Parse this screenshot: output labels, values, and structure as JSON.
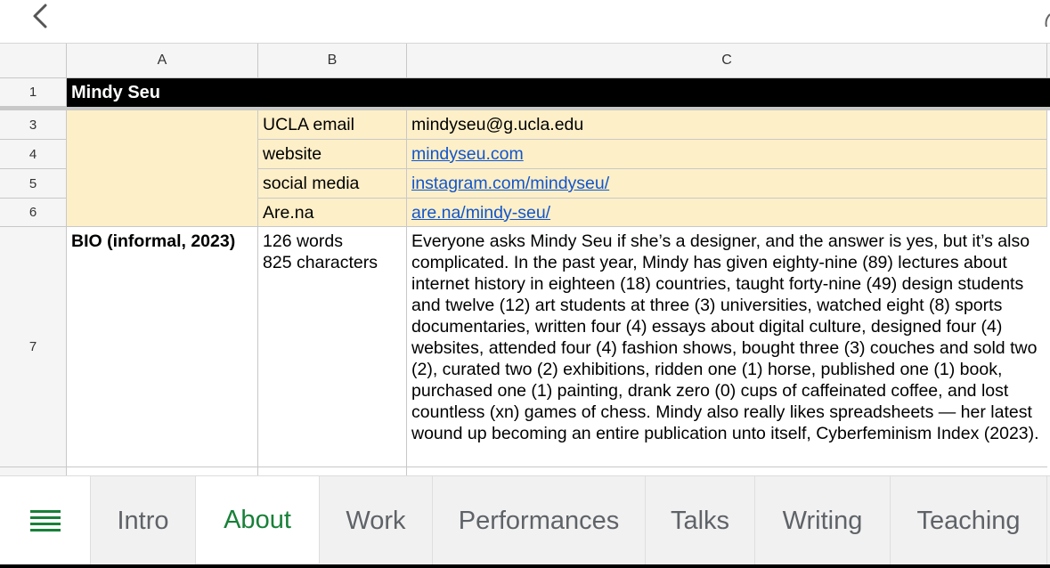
{
  "columns": [
    "A",
    "B",
    "C"
  ],
  "rows": [
    "1",
    "3",
    "4",
    "5",
    "6",
    "7"
  ],
  "title": "Mindy Seu",
  "contacts": [
    {
      "label": "UCLA email",
      "value": "mindyseu@g.ucla.edu"
    },
    {
      "label": "website",
      "value": "mindyseu.com"
    },
    {
      "label": "social media",
      "value": "instagram.com/mindyseu/"
    },
    {
      "label": "Are.na",
      "value": "are.na/mindy-seu/"
    }
  ],
  "bio": {
    "label": "BIO (informal, 2023)",
    "words": "126 words",
    "characters": "825 characters",
    "text": "Everyone asks Mindy Seu if she’s a designer, and the answer is yes, but it’s also complicated. In the past year, Mindy has given eighty-nine (89) lectures about internet history in eighteen (18) countries, taught forty-nine (49) design students and twelve (12) art students at three (3) universities, watched eight (8) sports documentaries, written four (4) essays about digital culture, designed four (4) websites, attended four (4) fashion shows, bought three (3) couches and sold two (2), curated two (2) exhibitions, ridden one (1) horse, published one (1) book, purchased one (1) painting, drank zero (0) cups of caffeinated coffee, and lost countless (xn) games of chess. Mindy also really likes spreadsheets — her latest wound up becoming an entire publication unto itself, Cyberfeminism Index (2023)."
  },
  "tabs": [
    "Intro",
    "About",
    "Work",
    "Performances",
    "Talks",
    "Writing",
    "Teaching"
  ],
  "active_tab": "About",
  "icons": {
    "back": "chevron-left-icon",
    "menu": "sheet-list-icon"
  },
  "colors": {
    "accent": "#188038",
    "highlight": "#fdefc8",
    "link": "#1155cc"
  }
}
